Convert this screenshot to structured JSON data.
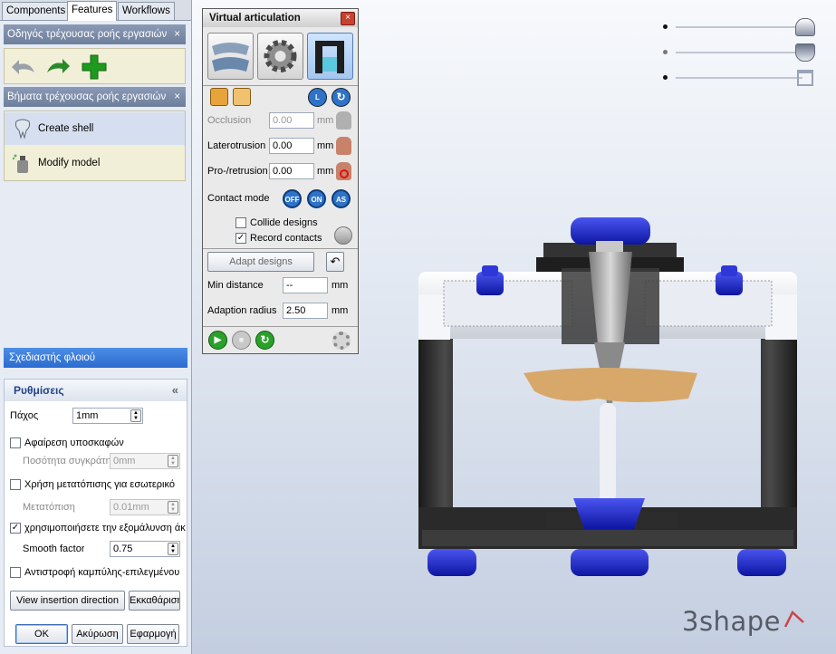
{
  "tabs": [
    {
      "label": "Components"
    },
    {
      "label": "Features"
    },
    {
      "label": "Workflows"
    }
  ],
  "workflow_guide": {
    "title": "Οδηγός τρέχουσας ροής εργασιών",
    "close": "×"
  },
  "workflow_steps": {
    "title": "Βήματα τρέχουσας ροής εργασιών",
    "close": "×",
    "items": [
      {
        "label": "Create shell"
      },
      {
        "label": "Modify model"
      }
    ]
  },
  "shell_designer": {
    "title": "Σχεδιαστής φλοιού"
  },
  "settings": {
    "title": "Ρυθμίσεις",
    "collapse": "«",
    "thickness_label": "Πάχος",
    "thickness_value": "1mm",
    "remove_undercuts_label": "Αφαίρεση υποσκαφών",
    "gap_percent_label": "Ποσότητα συγκράτησης",
    "gap_percent_value": "0mm",
    "use_offset_label": "Χρήση μετατόπισης για εσωτερικό",
    "offset_label": "Μετατόπιση",
    "offset_value": "0.01mm",
    "use_smoothing_label": "χρησιμοποιήσετε την εξομάλυνση άκρων",
    "smooth_factor_label": "Smooth factor",
    "smooth_factor_value": "0.75",
    "invert_curve_label": "Αντιστροφή καμπύλης-επιλεγμένου",
    "view_insertion_label": "View insertion direction",
    "clear_label": "Εκκαθάριση",
    "ok_label": "OK",
    "cancel_label": "Ακύρωση",
    "apply_label": "Εφαρμογή",
    "remove_undercuts_checked": false,
    "use_offset_checked": false,
    "use_smoothing_checked": true,
    "invert_curve_checked": false
  },
  "articulation": {
    "title": "Virtual articulation",
    "close": "×",
    "mode_buttons": [
      {
        "name": "jaw-model"
      },
      {
        "name": "gear"
      },
      {
        "name": "articulator-frame"
      }
    ],
    "lock_icons": [
      "lock-icon",
      "unlock-icon"
    ],
    "right_icons": [
      "L",
      "rotate"
    ],
    "occlusion_label": "Occlusion",
    "occlusion_value": "0.00",
    "occlusion_unit": "mm",
    "laterotrusion_label": "Laterotrusion",
    "laterotrusion_value": "0.00",
    "laterotrusion_unit": "mm",
    "protrusion_label": "Pro-/retrusion",
    "protrusion_value": "0.00",
    "protrusion_unit": "mm",
    "contact_mode_label": "Contact mode",
    "contact_off": "OFF",
    "contact_on": "ON",
    "contact_as": "AS",
    "collide_label": "Collide designs",
    "collide_checked": false,
    "record_label": "Record contacts",
    "record_checked": true,
    "adapt_label": "Adapt designs",
    "min_distance_label": "Min distance",
    "min_distance_value": "--",
    "min_distance_unit": "mm",
    "adaption_radius_label": "Adaption radius",
    "adaption_radius_value": "2.50",
    "adaption_radius_unit": "mm"
  },
  "visibility_sliders": [
    {
      "name": "upper"
    },
    {
      "name": "lower"
    },
    {
      "name": "articulator"
    }
  ],
  "logo": "3shape",
  "colors": {
    "accent": "#2a6bd0",
    "articulator_blue": "#1a22c8",
    "frame_black": "#2c2c2c"
  }
}
